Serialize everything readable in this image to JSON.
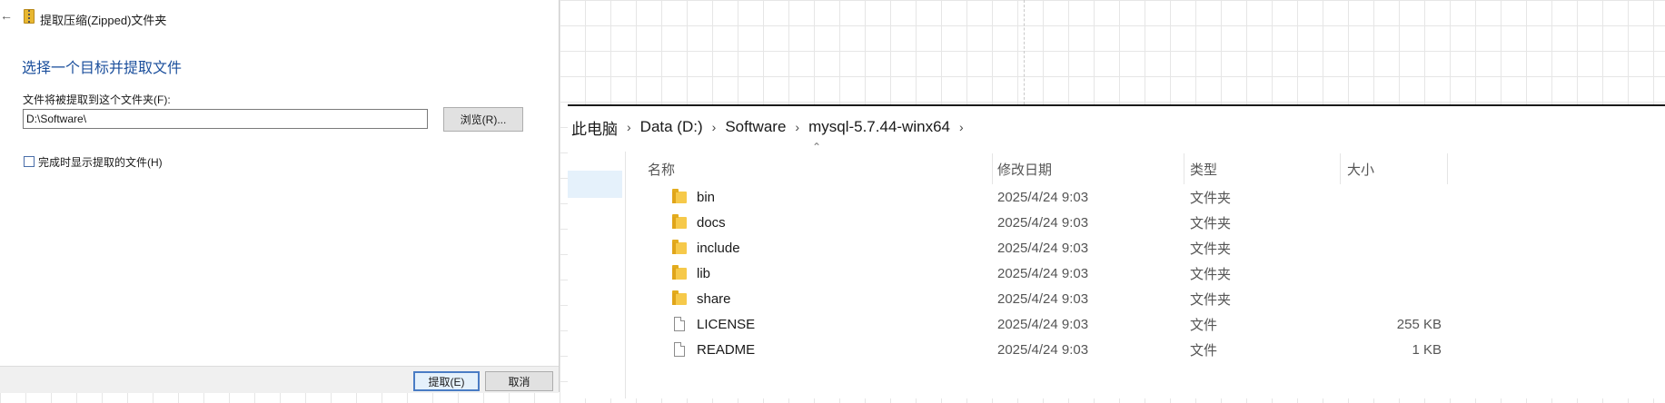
{
  "dialog": {
    "title": "提取压缩(Zipped)文件夹",
    "heading": "选择一个目标并提取文件",
    "field_label": "文件将被提取到这个文件夹(F):",
    "path_value": "D:\\Software\\",
    "browse_label": "浏览(R)...",
    "show_files_label": "完成时显示提取的文件(H)",
    "show_files_checked": false,
    "extract_label": "提取(E)",
    "cancel_label": "取消"
  },
  "explorer": {
    "breadcrumb": [
      "此电脑",
      "Data (D:)",
      "Software",
      "mysql-5.7.44-winx64"
    ],
    "columns": {
      "name": "名称",
      "date": "修改日期",
      "type": "类型",
      "size": "大小"
    },
    "rows": [
      {
        "name": "bin",
        "date": "2025/4/24 9:03",
        "type": "文件夹",
        "size": "",
        "icon": "folder-icon"
      },
      {
        "name": "docs",
        "date": "2025/4/24 9:03",
        "type": "文件夹",
        "size": "",
        "icon": "folder-icon"
      },
      {
        "name": "include",
        "date": "2025/4/24 9:03",
        "type": "文件夹",
        "size": "",
        "icon": "folder-icon"
      },
      {
        "name": "lib",
        "date": "2025/4/24 9:03",
        "type": "文件夹",
        "size": "",
        "icon": "folder-icon"
      },
      {
        "name": "share",
        "date": "2025/4/24 9:03",
        "type": "文件夹",
        "size": "",
        "icon": "folder-icon"
      },
      {
        "name": "LICENSE",
        "date": "2025/4/24 9:03",
        "type": "文件",
        "size": "255 KB",
        "icon": "file-icon"
      },
      {
        "name": "README",
        "date": "2025/4/24 9:03",
        "type": "文件",
        "size": "1 KB",
        "icon": "file-icon"
      }
    ]
  },
  "colors": {
    "heading_blue": "#1b4f9c",
    "selection": "#e5f1fb",
    "folder": "#f6c94a"
  }
}
